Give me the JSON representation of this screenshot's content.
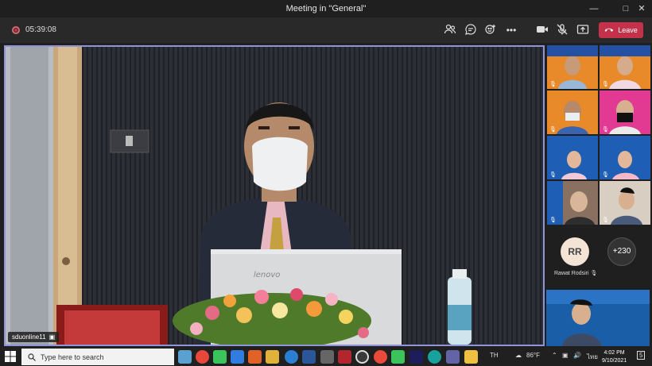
{
  "window": {
    "title": "Meeting in \"General\""
  },
  "toolbar": {
    "timer": "05:39:08",
    "leave_label": "Leave"
  },
  "main_video": {
    "participant_name": "sduonline11"
  },
  "gallery": {
    "tiles": [
      {
        "id": "p1"
      },
      {
        "id": "p2"
      },
      {
        "id": "p3"
      },
      {
        "id": "p4"
      },
      {
        "id": "p5"
      },
      {
        "id": "p6"
      },
      {
        "id": "p7"
      },
      {
        "id": "p8"
      }
    ],
    "avatar_initials": "RR",
    "avatar_name": "Rawat Rodsiri",
    "overflow_count": "+230"
  },
  "taskbar": {
    "search_placeholder": "Type here to search",
    "language": "TH",
    "temperature": "86°F",
    "ime": "ไทย",
    "time": "4:02 PM",
    "date": "9/10/2021",
    "notification_count": "5"
  },
  "colors": {
    "accent_border": "#8f93d8",
    "leave_red": "#c4314b"
  }
}
